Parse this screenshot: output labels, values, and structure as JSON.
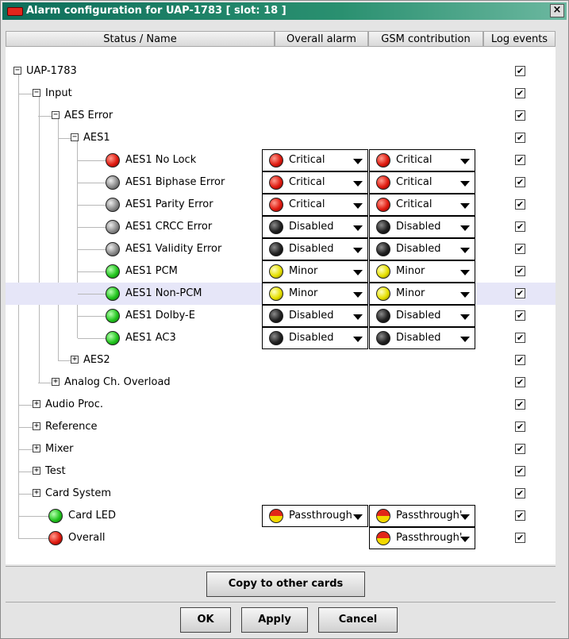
{
  "window": {
    "title": "Alarm configuration for UAP-1783 [ slot: 18 ]",
    "close": "×"
  },
  "columns": [
    "Status / Name",
    "Overall alarm",
    "GSM contribution",
    "Log events"
  ],
  "toggle": {
    "expanded": "−",
    "collapsed": "+"
  },
  "check_mark": "✔",
  "tree": [
    {
      "label": "UAP-1783",
      "toggle": "expanded",
      "log": true
    },
    {
      "label": "Input",
      "toggle": "expanded",
      "log": true
    },
    {
      "label": "AES Error",
      "toggle": "expanded",
      "log": true
    },
    {
      "label": "AES1",
      "toggle": "expanded",
      "log": true
    },
    {
      "label": "AES1 No Lock",
      "led": "red",
      "overall": {
        "value": "Critical",
        "led": "red"
      },
      "gsm": {
        "value": "Critical",
        "led": "red"
      },
      "log": true
    },
    {
      "label": "AES1 Biphase Error",
      "led": "gray",
      "overall": {
        "value": "Critical",
        "led": "red"
      },
      "gsm": {
        "value": "Critical",
        "led": "red"
      },
      "log": true
    },
    {
      "label": "AES1 Parity Error",
      "led": "gray",
      "overall": {
        "value": "Critical",
        "led": "red"
      },
      "gsm": {
        "value": "Critical",
        "led": "red"
      },
      "log": true
    },
    {
      "label": "AES1 CRCC Error",
      "led": "gray",
      "overall": {
        "value": "Disabled",
        "led": "black"
      },
      "gsm": {
        "value": "Disabled",
        "led": "black"
      },
      "log": true
    },
    {
      "label": "AES1 Validity Error",
      "led": "gray",
      "overall": {
        "value": "Disabled",
        "led": "black"
      },
      "gsm": {
        "value": "Disabled",
        "led": "black"
      },
      "log": true
    },
    {
      "label": "AES1 PCM",
      "led": "green",
      "overall": {
        "value": "Minor",
        "led": "yellow"
      },
      "gsm": {
        "value": "Minor",
        "led": "yellow"
      },
      "log": true
    },
    {
      "label": "AES1 Non-PCM",
      "led": "green",
      "overall": {
        "value": "Minor",
        "led": "yellow"
      },
      "gsm": {
        "value": "Minor",
        "led": "yellow"
      },
      "log": true,
      "selected": true
    },
    {
      "label": "AES1 Dolby-E",
      "led": "green",
      "overall": {
        "value": "Disabled",
        "led": "black"
      },
      "gsm": {
        "value": "Disabled",
        "led": "black"
      },
      "log": true
    },
    {
      "label": "AES1 AC3",
      "led": "green",
      "overall": {
        "value": "Disabled",
        "led": "black"
      },
      "gsm": {
        "value": "Disabled",
        "led": "black"
      },
      "log": true
    },
    {
      "label": "AES2",
      "toggle": "collapsed",
      "log": true
    },
    {
      "label": "Analog Ch. Overload",
      "toggle": "collapsed",
      "log": true
    },
    {
      "label": "Audio Proc.",
      "toggle": "collapsed",
      "log": true
    },
    {
      "label": "Reference",
      "toggle": "collapsed",
      "log": true
    },
    {
      "label": "Mixer",
      "toggle": "collapsed",
      "log": true
    },
    {
      "label": "Test",
      "toggle": "collapsed",
      "log": true
    },
    {
      "label": "Card System",
      "toggle": "collapsed",
      "log": true
    },
    {
      "label": "Card LED",
      "led": "green",
      "overall": {
        "value": "Passthrough",
        "led": "pass"
      },
      "gsm": {
        "value": "Passthrough'",
        "led": "pass"
      },
      "log": true
    },
    {
      "label": "Overall",
      "led": "red",
      "gsm": {
        "value": "Passthrough'",
        "led": "pass"
      },
      "log": true
    }
  ],
  "buttons": {
    "copy": "Copy to other cards",
    "ok": "OK",
    "apply": "Apply",
    "cancel": "Cancel"
  },
  "colors": {
    "title_bar": "#0e6e5b",
    "selected_row": "#e6e6f8"
  }
}
